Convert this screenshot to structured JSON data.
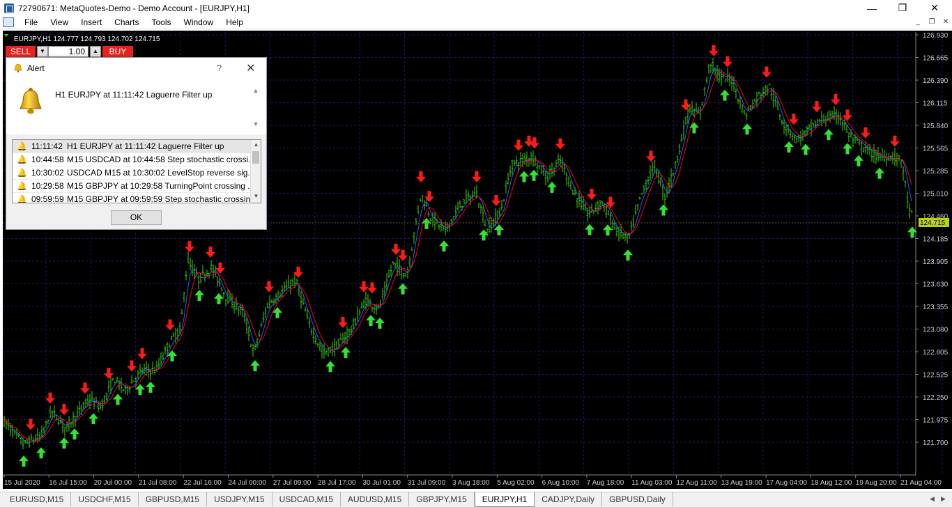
{
  "window": {
    "title": "72790671: MetaQuotes-Demo - Demo Account - [EURJPY,H1]",
    "minimize": "—",
    "maximize": "❐",
    "close": "✕"
  },
  "menu": {
    "items": [
      "File",
      "View",
      "Insert",
      "Charts",
      "Tools",
      "Window",
      "Help"
    ],
    "mdi_minimize": "_",
    "mdi_restore": "❐",
    "mdi_close": "✕"
  },
  "chart": {
    "header": "EURJPY,H1  124.777 124.793 124.702 124.715",
    "current_price": "124.715",
    "price_labels": [
      "126.930",
      "126.665",
      "126.390",
      "126.115",
      "125.840",
      "125.565",
      "125.285",
      "125.010",
      "124.460",
      "124.185",
      "123.905",
      "123.630",
      "123.355",
      "123.080",
      "122.805",
      "122.525",
      "122.250",
      "121.975",
      "121.700"
    ],
    "time_labels": [
      "15 Jul 2020",
      "16 Jul 15:00",
      "20 Jul 00:00",
      "21 Jul 08:00",
      "22 Jul 16:00",
      "24 Jul 00:00",
      "27 Jul 09:00",
      "28 Jul 17:00",
      "30 Jul 01:00",
      "31 Jul 09:00",
      "3 Aug 18:00",
      "5 Aug 02:00",
      "6 Aug 10:00",
      "7 Aug 18:00",
      "11 Aug 03:00",
      "12 Aug 11:00",
      "13 Aug 19:00",
      "17 Aug 04:00",
      "18 Aug 12:00",
      "19 Aug 20:00",
      "21 Aug 04:00"
    ],
    "colors": {
      "background": "#000000",
      "bars": "#3cd200",
      "ma_red": "#ff0000",
      "ma_blue": "#2060ff",
      "grid": "#1a1a6a",
      "up_arrow": "#33e233",
      "down_arrow": "#ff1a1a"
    }
  },
  "trade_panel": {
    "sell_label": "SELL",
    "buy_label": "BUY",
    "volume": "1.00"
  },
  "alert": {
    "title": "Alert",
    "help": "?",
    "close": "✕",
    "message": "H1 EURJPY at 11:11:42 Laguerre Filter  up",
    "rows": [
      {
        "time": "11:11:42",
        "text": "H1 EURJPY at 11:11:42 Laguerre Filter  up"
      },
      {
        "time": "10:44:58",
        "text": "M15 USDCAD at 10:44:58 Step stochastic  crossi..."
      },
      {
        "time": "10:30:02",
        "text": "USDCAD M15 at 10:30:02 LevelStop reverse sig..."
      },
      {
        "time": "10:29:58",
        "text": "M15 GBPJPY at 10:29:58 TurningPoint crossing ..."
      },
      {
        "time": "09:59:59",
        "text": "M15 GBPJPY at 09:59:59 Step stochastic  crossin..."
      }
    ],
    "ok_label": "OK"
  },
  "tabs": [
    "EURUSD,M15",
    "USDCHF,M15",
    "GBPUSD,M15",
    "USDJPY,M15",
    "USDCAD,M15",
    "AUDUSD,M15",
    "GBPJPY,M15",
    "EURJPY,H1",
    "CADJPY,Daily",
    "GBPUSD,Daily"
  ],
  "active_tab": "EURJPY,H1"
}
